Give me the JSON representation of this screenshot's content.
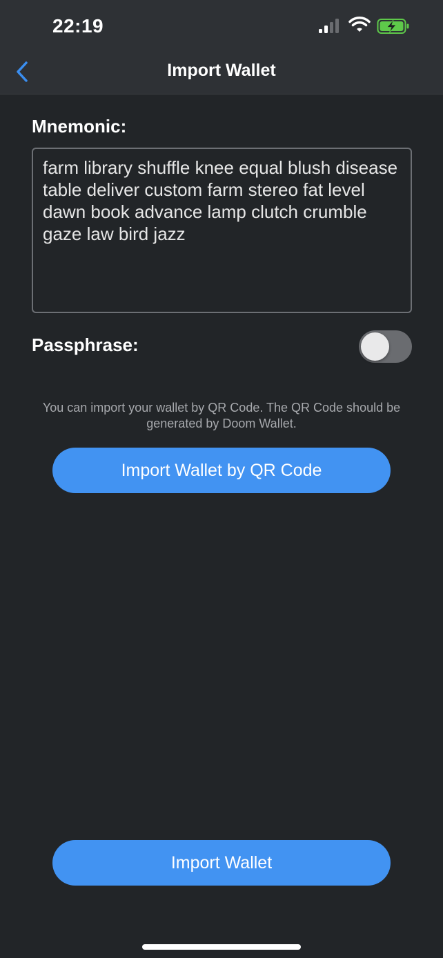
{
  "status_bar": {
    "time": "22:19",
    "icons": [
      "cellular-signal-icon",
      "wifi-icon",
      "battery-charging-icon"
    ],
    "battery_color": "#5ec94a"
  },
  "nav": {
    "back_icon": "chevron-left-icon",
    "title": "Import Wallet",
    "accent": "#3a8ef0"
  },
  "mnemonic": {
    "label": "Mnemonic:",
    "value": "farm library shuffle knee equal blush disease table deliver custom farm stereo fat level dawn book advance lamp clutch crumble gaze law bird jazz"
  },
  "passphrase": {
    "label": "Passphrase:",
    "enabled": false
  },
  "qr": {
    "hint": "You can import your wallet by QR Code. The QR Code should be generated by Doom Wallet.",
    "button_label": "Import Wallet by QR Code"
  },
  "footer": {
    "import_button_label": "Import Wallet"
  },
  "colors": {
    "background": "#222528",
    "button": "#4293f2"
  }
}
